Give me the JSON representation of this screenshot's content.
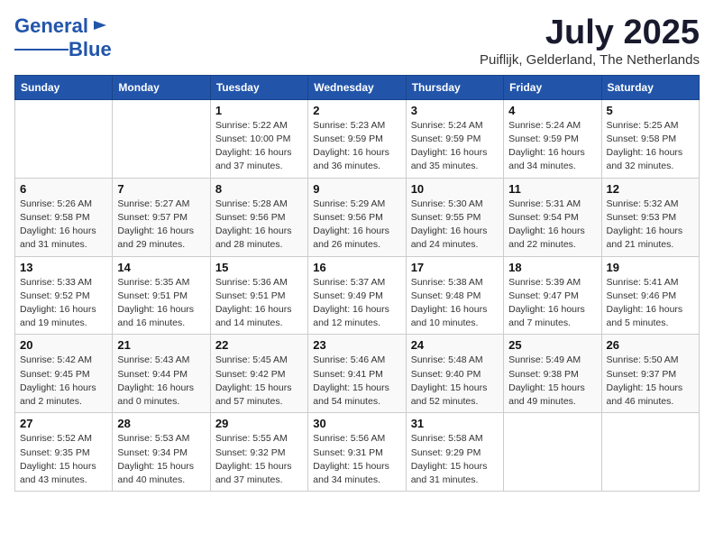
{
  "header": {
    "logo_general": "General",
    "logo_blue": "Blue",
    "month_title": "July 2025",
    "subtitle": "Puiflijk, Gelderland, The Netherlands"
  },
  "weekdays": [
    "Sunday",
    "Monday",
    "Tuesday",
    "Wednesday",
    "Thursday",
    "Friday",
    "Saturday"
  ],
  "weeks": [
    [
      {
        "day": "",
        "sunrise": "",
        "sunset": "",
        "daylight": ""
      },
      {
        "day": "",
        "sunrise": "",
        "sunset": "",
        "daylight": ""
      },
      {
        "day": "1",
        "sunrise": "Sunrise: 5:22 AM",
        "sunset": "Sunset: 10:00 PM",
        "daylight": "Daylight: 16 hours and 37 minutes."
      },
      {
        "day": "2",
        "sunrise": "Sunrise: 5:23 AM",
        "sunset": "Sunset: 9:59 PM",
        "daylight": "Daylight: 16 hours and 36 minutes."
      },
      {
        "day": "3",
        "sunrise": "Sunrise: 5:24 AM",
        "sunset": "Sunset: 9:59 PM",
        "daylight": "Daylight: 16 hours and 35 minutes."
      },
      {
        "day": "4",
        "sunrise": "Sunrise: 5:24 AM",
        "sunset": "Sunset: 9:59 PM",
        "daylight": "Daylight: 16 hours and 34 minutes."
      },
      {
        "day": "5",
        "sunrise": "Sunrise: 5:25 AM",
        "sunset": "Sunset: 9:58 PM",
        "daylight": "Daylight: 16 hours and 32 minutes."
      }
    ],
    [
      {
        "day": "6",
        "sunrise": "Sunrise: 5:26 AM",
        "sunset": "Sunset: 9:58 PM",
        "daylight": "Daylight: 16 hours and 31 minutes."
      },
      {
        "day": "7",
        "sunrise": "Sunrise: 5:27 AM",
        "sunset": "Sunset: 9:57 PM",
        "daylight": "Daylight: 16 hours and 29 minutes."
      },
      {
        "day": "8",
        "sunrise": "Sunrise: 5:28 AM",
        "sunset": "Sunset: 9:56 PM",
        "daylight": "Daylight: 16 hours and 28 minutes."
      },
      {
        "day": "9",
        "sunrise": "Sunrise: 5:29 AM",
        "sunset": "Sunset: 9:56 PM",
        "daylight": "Daylight: 16 hours and 26 minutes."
      },
      {
        "day": "10",
        "sunrise": "Sunrise: 5:30 AM",
        "sunset": "Sunset: 9:55 PM",
        "daylight": "Daylight: 16 hours and 24 minutes."
      },
      {
        "day": "11",
        "sunrise": "Sunrise: 5:31 AM",
        "sunset": "Sunset: 9:54 PM",
        "daylight": "Daylight: 16 hours and 22 minutes."
      },
      {
        "day": "12",
        "sunrise": "Sunrise: 5:32 AM",
        "sunset": "Sunset: 9:53 PM",
        "daylight": "Daylight: 16 hours and 21 minutes."
      }
    ],
    [
      {
        "day": "13",
        "sunrise": "Sunrise: 5:33 AM",
        "sunset": "Sunset: 9:52 PM",
        "daylight": "Daylight: 16 hours and 19 minutes."
      },
      {
        "day": "14",
        "sunrise": "Sunrise: 5:35 AM",
        "sunset": "Sunset: 9:51 PM",
        "daylight": "Daylight: 16 hours and 16 minutes."
      },
      {
        "day": "15",
        "sunrise": "Sunrise: 5:36 AM",
        "sunset": "Sunset: 9:51 PM",
        "daylight": "Daylight: 16 hours and 14 minutes."
      },
      {
        "day": "16",
        "sunrise": "Sunrise: 5:37 AM",
        "sunset": "Sunset: 9:49 PM",
        "daylight": "Daylight: 16 hours and 12 minutes."
      },
      {
        "day": "17",
        "sunrise": "Sunrise: 5:38 AM",
        "sunset": "Sunset: 9:48 PM",
        "daylight": "Daylight: 16 hours and 10 minutes."
      },
      {
        "day": "18",
        "sunrise": "Sunrise: 5:39 AM",
        "sunset": "Sunset: 9:47 PM",
        "daylight": "Daylight: 16 hours and 7 minutes."
      },
      {
        "day": "19",
        "sunrise": "Sunrise: 5:41 AM",
        "sunset": "Sunset: 9:46 PM",
        "daylight": "Daylight: 16 hours and 5 minutes."
      }
    ],
    [
      {
        "day": "20",
        "sunrise": "Sunrise: 5:42 AM",
        "sunset": "Sunset: 9:45 PM",
        "daylight": "Daylight: 16 hours and 2 minutes."
      },
      {
        "day": "21",
        "sunrise": "Sunrise: 5:43 AM",
        "sunset": "Sunset: 9:44 PM",
        "daylight": "Daylight: 16 hours and 0 minutes."
      },
      {
        "day": "22",
        "sunrise": "Sunrise: 5:45 AM",
        "sunset": "Sunset: 9:42 PM",
        "daylight": "Daylight: 15 hours and 57 minutes."
      },
      {
        "day": "23",
        "sunrise": "Sunrise: 5:46 AM",
        "sunset": "Sunset: 9:41 PM",
        "daylight": "Daylight: 15 hours and 54 minutes."
      },
      {
        "day": "24",
        "sunrise": "Sunrise: 5:48 AM",
        "sunset": "Sunset: 9:40 PM",
        "daylight": "Daylight: 15 hours and 52 minutes."
      },
      {
        "day": "25",
        "sunrise": "Sunrise: 5:49 AM",
        "sunset": "Sunset: 9:38 PM",
        "daylight": "Daylight: 15 hours and 49 minutes."
      },
      {
        "day": "26",
        "sunrise": "Sunrise: 5:50 AM",
        "sunset": "Sunset: 9:37 PM",
        "daylight": "Daylight: 15 hours and 46 minutes."
      }
    ],
    [
      {
        "day": "27",
        "sunrise": "Sunrise: 5:52 AM",
        "sunset": "Sunset: 9:35 PM",
        "daylight": "Daylight: 15 hours and 43 minutes."
      },
      {
        "day": "28",
        "sunrise": "Sunrise: 5:53 AM",
        "sunset": "Sunset: 9:34 PM",
        "daylight": "Daylight: 15 hours and 40 minutes."
      },
      {
        "day": "29",
        "sunrise": "Sunrise: 5:55 AM",
        "sunset": "Sunset: 9:32 PM",
        "daylight": "Daylight: 15 hours and 37 minutes."
      },
      {
        "day": "30",
        "sunrise": "Sunrise: 5:56 AM",
        "sunset": "Sunset: 9:31 PM",
        "daylight": "Daylight: 15 hours and 34 minutes."
      },
      {
        "day": "31",
        "sunrise": "Sunrise: 5:58 AM",
        "sunset": "Sunset: 9:29 PM",
        "daylight": "Daylight: 15 hours and 31 minutes."
      },
      {
        "day": "",
        "sunrise": "",
        "sunset": "",
        "daylight": ""
      },
      {
        "day": "",
        "sunrise": "",
        "sunset": "",
        "daylight": ""
      }
    ]
  ]
}
